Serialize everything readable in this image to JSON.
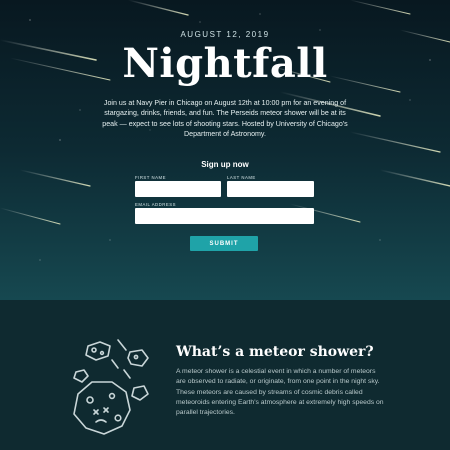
{
  "hero": {
    "date": "AUGUST 12, 2019",
    "title": "Nightfall",
    "description": "Join us at Navy Pier in Chicago on August 12th at 10:00 pm for an evening of stargazing, drinks, friends, and fun. The Perseids meteor shower will be at its peak — expect to see lots of shooting stars. Hosted by University of Chicago's Department of Astronomy."
  },
  "form": {
    "heading": "Sign up now",
    "first_name_label": "FIRST NAME",
    "last_name_label": "LAST NAME",
    "email_label": "EMAIL ADDRESS",
    "first_name_value": "",
    "last_name_value": "",
    "email_value": "",
    "submit_label": "SUBMIT"
  },
  "info": {
    "title": "What’s a meteor shower?",
    "text": "A meteor shower is a celestial event in which a number of meteors are observed to radiate, or originate, from one point in the night sky. These meteors are caused by streams of cosmic debris called meteoroids entering Earth's atmosphere at extremely high speeds on parallel trajectories."
  },
  "colors": {
    "accent": "#1fa3a8",
    "hero_top": "#081820",
    "hero_bottom": "#164850",
    "info_bg": "#0f2a30"
  },
  "icons": [
    "meteor-illustration-icon"
  ]
}
